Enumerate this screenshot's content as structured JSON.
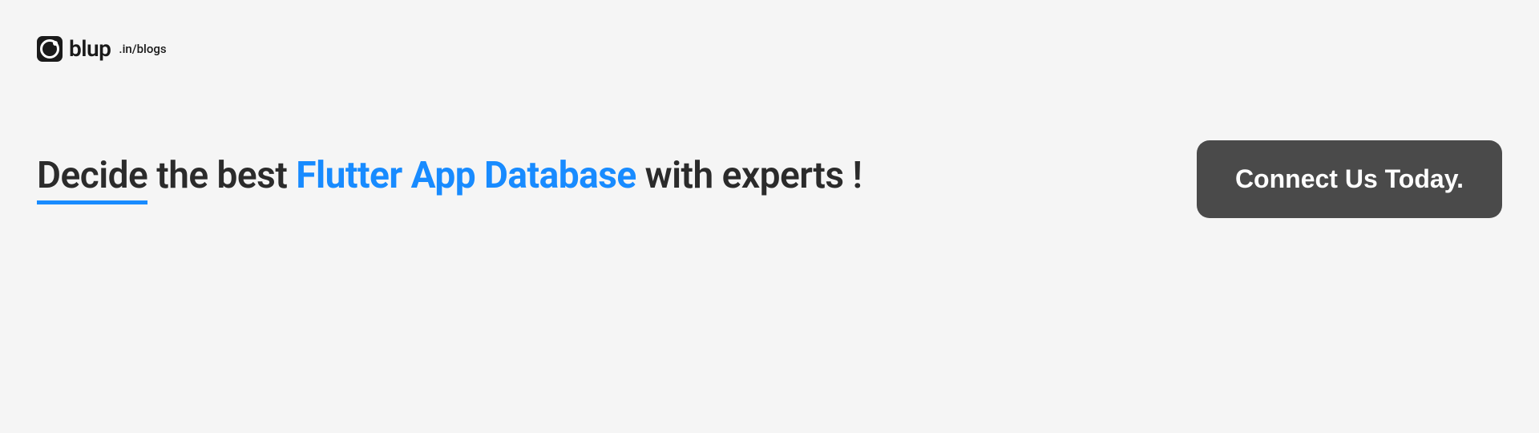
{
  "header": {
    "brand_name": "blup",
    "brand_suffix": ".in/blogs"
  },
  "main": {
    "headline_part1": "Decide",
    "headline_part2": " the best ",
    "headline_highlight": "Flutter App Database",
    "headline_part3": " with experts !"
  },
  "cta": {
    "label": "Connect Us Today."
  }
}
